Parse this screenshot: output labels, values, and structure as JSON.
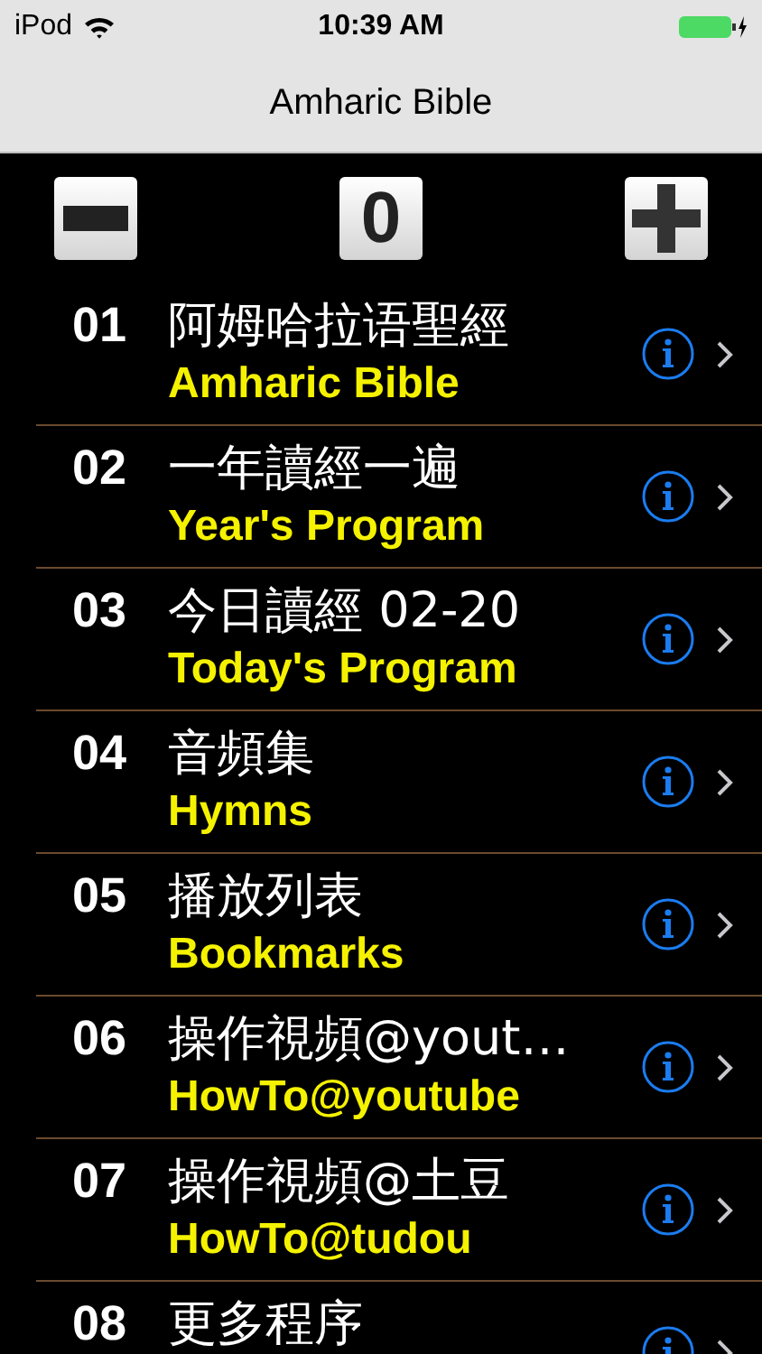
{
  "status_bar": {
    "carrier": "iPod",
    "time": "10:39 AM"
  },
  "nav_bar": {
    "title": "Amharic Bible"
  },
  "toolbar": {
    "counter": "0"
  },
  "items": [
    {
      "number": "01",
      "title": "阿姆哈拉语聖經",
      "subtitle": "Amharic Bible"
    },
    {
      "number": "02",
      "title": "一年讀經一遍",
      "subtitle": "Year's Program"
    },
    {
      "number": "03",
      "title": "今日讀經 02-20",
      "subtitle": "Today's Program"
    },
    {
      "number": "04",
      "title": "音頻集",
      "subtitle": "Hymns"
    },
    {
      "number": "05",
      "title": "播放列表",
      "subtitle": "Bookmarks"
    },
    {
      "number": "06",
      "title": "操作視頻@yout…",
      "subtitle": "HowTo@youtube"
    },
    {
      "number": "07",
      "title": "操作視頻@土豆",
      "subtitle": "HowTo@tudou"
    },
    {
      "number": "08",
      "title": "更多程序"
    }
  ]
}
